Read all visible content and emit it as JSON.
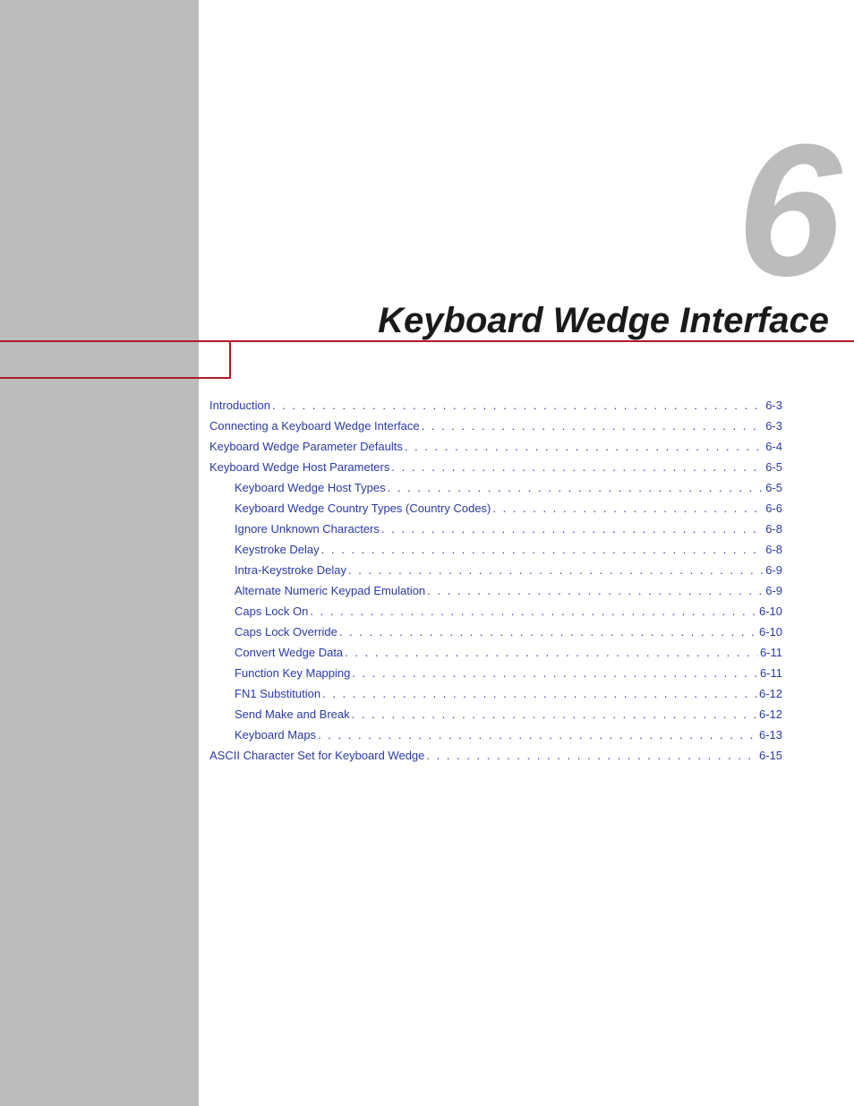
{
  "chapter": {
    "number": "6",
    "title": "Keyboard Wedge Interface"
  },
  "toc": [
    {
      "label": "Introduction",
      "page": "6-3",
      "indent": 0
    },
    {
      "label": "Connecting a Keyboard Wedge Interface",
      "page": "6-3",
      "indent": 0
    },
    {
      "label": "Keyboard Wedge Parameter Defaults",
      "page": "6-4",
      "indent": 0
    },
    {
      "label": "Keyboard Wedge Host Parameters",
      "page": "6-5",
      "indent": 0
    },
    {
      "label": "Keyboard Wedge Host Types",
      "page": "6-5",
      "indent": 1
    },
    {
      "label": "Keyboard Wedge Country Types (Country Codes)",
      "page": "6-6",
      "indent": 1
    },
    {
      "label": "Ignore Unknown Characters",
      "page": "6-8",
      "indent": 1
    },
    {
      "label": "Keystroke Delay",
      "page": "6-8",
      "indent": 1
    },
    {
      "label": "Intra-Keystroke Delay",
      "page": "6-9",
      "indent": 1
    },
    {
      "label": "Alternate Numeric Keypad Emulation",
      "page": "6-9",
      "indent": 1
    },
    {
      "label": "Caps Lock On",
      "page": "6-10",
      "indent": 1
    },
    {
      "label": "Caps Lock Override",
      "page": "6-10",
      "indent": 1
    },
    {
      "label": "Convert Wedge Data",
      "page": "6-11",
      "indent": 1
    },
    {
      "label": "Function Key Mapping",
      "page": "6-11",
      "indent": 1
    },
    {
      "label": "FN1 Substitution",
      "page": "6-12",
      "indent": 1
    },
    {
      "label": "Send Make and Break",
      "page": "6-12",
      "indent": 1
    },
    {
      "label": "Keyboard Maps",
      "page": "6-13",
      "indent": 1
    },
    {
      "label": "ASCII Character Set for Keyboard Wedge",
      "page": "6-15",
      "indent": 0
    }
  ],
  "leader_dots": ". . . . . . . . . . . . . . . . . . . . . . . . . . . . . . . . . . . . . . . . . . . . . . . . . . . . . . . . . . . . . . . . . . . . . . . . . . . . . . . . . . . . . . . . . . . . . . . . . . . . . . . . . . . . . . . . . . . . . . . . ."
}
